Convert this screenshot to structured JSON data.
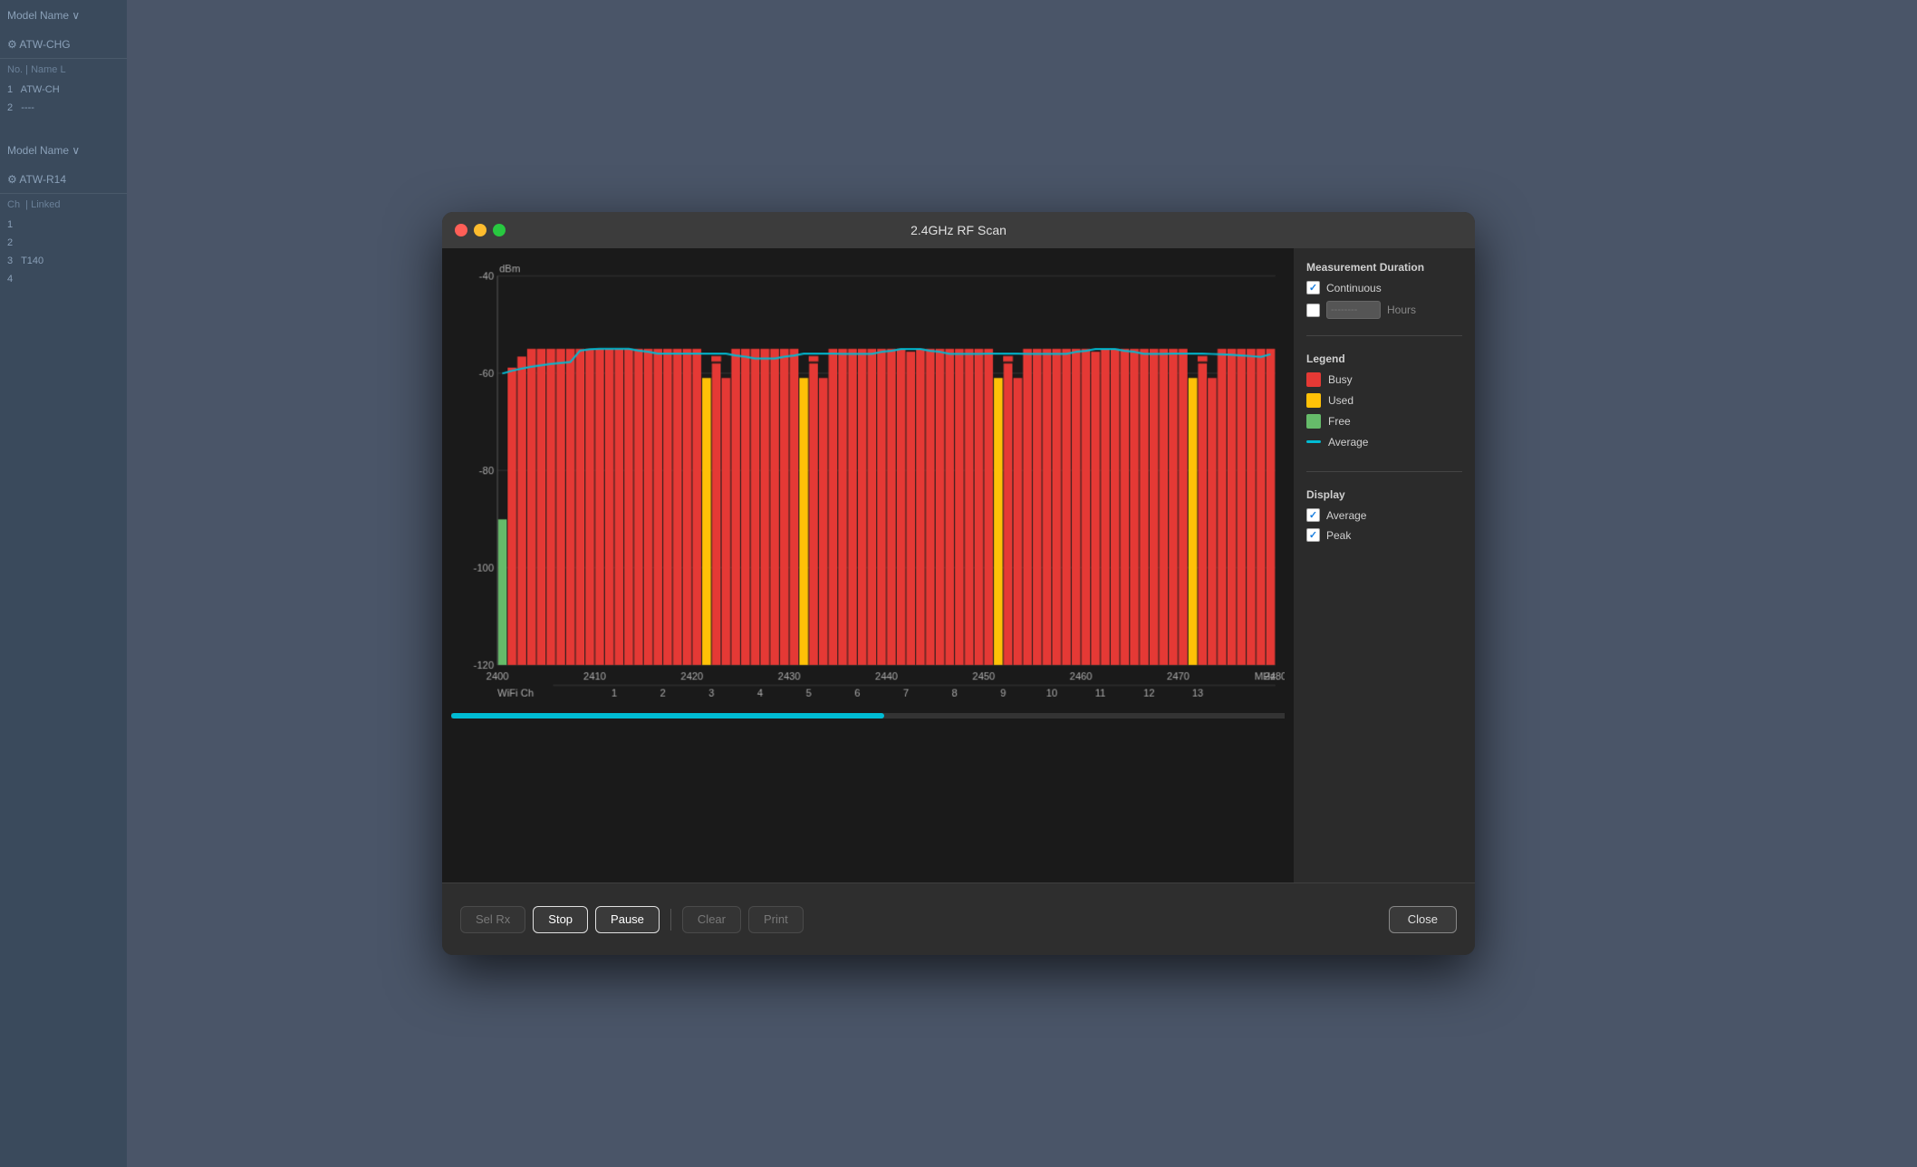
{
  "window": {
    "title": "2.4GHz RF Scan"
  },
  "titlebar": {
    "close_label": "",
    "minimize_label": "",
    "maximize_label": ""
  },
  "chart": {
    "y_axis_label": "dBm",
    "y_ticks": [
      "-40",
      "-60",
      "-80",
      "-100",
      "-120"
    ],
    "x_ticks": [
      "2400",
      "2410",
      "2420",
      "2430",
      "2440",
      "2450",
      "2460",
      "2470",
      "2480"
    ],
    "x_unit": "MHz",
    "wifi_ch_label": "WiFi Ch",
    "wifi_channels": [
      "1",
      "2",
      "3",
      "4",
      "5",
      "6",
      "7",
      "8",
      "9",
      "10",
      "11",
      "12",
      "13"
    ]
  },
  "measurement_duration": {
    "title": "Measurement Duration",
    "continuous_label": "Continuous",
    "continuous_checked": true,
    "hours_checked": false,
    "hours_placeholder": "--------",
    "hours_label": "Hours"
  },
  "legend": {
    "title": "Legend",
    "items": [
      {
        "label": "Busy",
        "color": "#e53935"
      },
      {
        "label": "Used",
        "color": "#ffc107"
      },
      {
        "label": "Free",
        "color": "#66bb6a"
      },
      {
        "label": "Average",
        "color": "#00bcd4",
        "is_line": true
      }
    ]
  },
  "display": {
    "title": "Display",
    "average_label": "Average",
    "average_checked": true,
    "peak_label": "Peak",
    "peak_checked": true
  },
  "buttons": {
    "sel_rx": "Sel Rx",
    "stop": "Stop",
    "pause": "Pause",
    "clear": "Clear",
    "print": "Print",
    "close": "Close"
  },
  "colors": {
    "busy": "#e53935",
    "used": "#ffc107",
    "free": "#66bb6a",
    "average": "#00bcd4",
    "background": "#1a1a1a",
    "grid": "#333333"
  }
}
